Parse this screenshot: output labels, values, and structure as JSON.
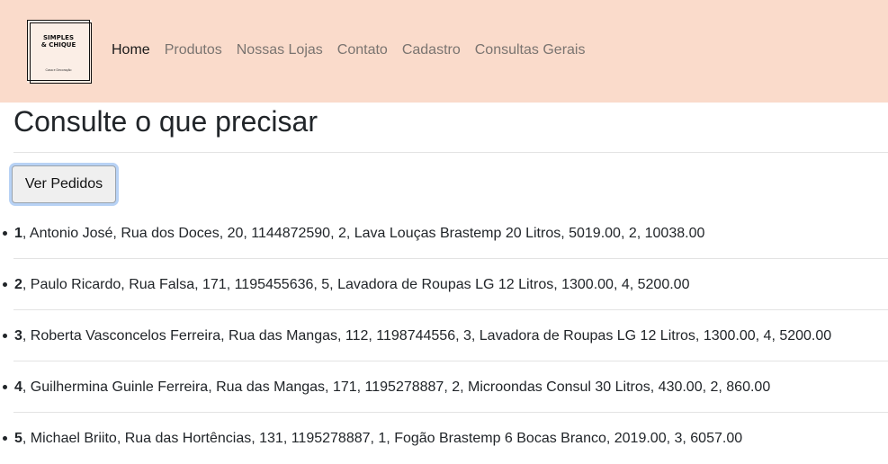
{
  "brand": {
    "logo_title": "SIMPLES\n& CHIQUE",
    "logo_subtitle": "Casa e Decoração"
  },
  "nav": {
    "items": [
      {
        "label": "Home",
        "active": true
      },
      {
        "label": "Produtos",
        "active": false
      },
      {
        "label": "Nossas Lojas",
        "active": false
      },
      {
        "label": "Contato",
        "active": false
      },
      {
        "label": "Cadastro",
        "active": false
      },
      {
        "label": "Consultas Gerais",
        "active": false
      }
    ]
  },
  "main": {
    "title": "Consulte o que precisar",
    "button_label": "Ver Pedidos"
  },
  "orders": [
    {
      "id": "1",
      "details": ", Antonio José, Rua dos Doces, 20, 1144872590, 2, Lava Louças Brastemp 20 Litros, 5019.00, 2, 10038.00"
    },
    {
      "id": "2",
      "details": ", Paulo Ricardo, Rua Falsa, 171, 1195455636, 5, Lavadora de Roupas LG 12 Litros, 1300.00, 4, 5200.00"
    },
    {
      "id": "3",
      "details": ", Roberta Vasconcelos Ferreira, Rua das Mangas, 112, 1198744556, 3, Lavadora de Roupas LG 12 Litros, 1300.00, 4, 5200.00"
    },
    {
      "id": "4",
      "details": ", Guilhermina Guinle Ferreira, Rua das Mangas, 171, 1195278887, 2, Microondas Consul 30 Litros, 430.00, 2, 860.00"
    },
    {
      "id": "5",
      "details": ", Michael Briito, Rua das Hortências, 131, 1195278887, 1, Fogão Brastemp 6 Bocas Branco, 2019.00, 3, 6057.00"
    }
  ],
  "colors": {
    "navbar_bg": "#fadbcb",
    "nav_link": "#7a7470",
    "nav_link_active": "#1a1a1a",
    "button_focus_ring": "#b8d2f5"
  }
}
